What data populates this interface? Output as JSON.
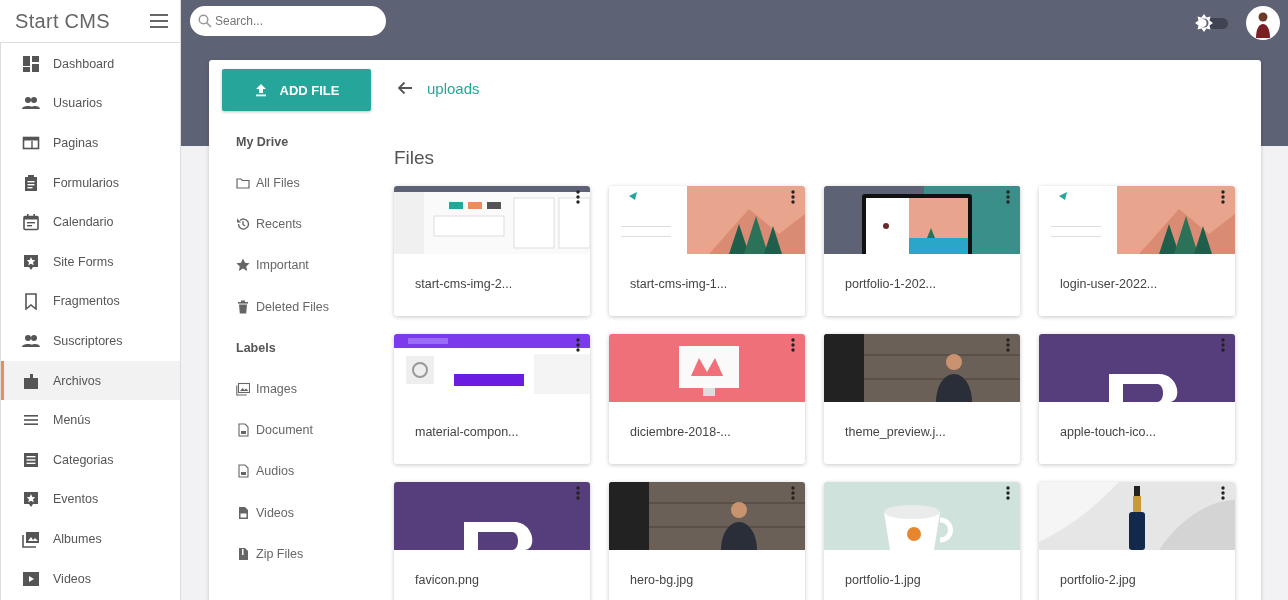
{
  "app": {
    "title": "Start CMS"
  },
  "search": {
    "placeholder": "Search..."
  },
  "theme_toggle": {
    "on": false
  },
  "sidebar": {
    "items": [
      {
        "label": "Dashboard",
        "selected": false
      },
      {
        "label": "Usuarios",
        "selected": false
      },
      {
        "label": "Paginas",
        "selected": false
      },
      {
        "label": "Formularios",
        "selected": false
      },
      {
        "label": "Calendario",
        "selected": false
      },
      {
        "label": "Site Forms",
        "selected": false
      },
      {
        "label": "Fragmentos",
        "selected": false
      },
      {
        "label": "Suscriptores",
        "selected": false
      },
      {
        "label": "Archivos",
        "selected": true
      },
      {
        "label": "Menús",
        "selected": false
      },
      {
        "label": "Categorias",
        "selected": false
      },
      {
        "label": "Eventos",
        "selected": false
      },
      {
        "label": "Albumes",
        "selected": false
      },
      {
        "label": "Videos",
        "selected": false
      }
    ]
  },
  "drive": {
    "add_button": "ADD FILE",
    "sections": [
      {
        "heading": "My Drive",
        "items": [
          "All Files",
          "Recents",
          "Important",
          "Deleted Files"
        ]
      },
      {
        "heading": "Labels",
        "items": [
          "Images",
          "Document",
          "Audios",
          "Videos",
          "Zip Files"
        ]
      }
    ]
  },
  "breadcrumb": {
    "folder": "uploads"
  },
  "files": {
    "heading": "Files",
    "items": [
      {
        "name": "start-cms-img-2..."
      },
      {
        "name": "start-cms-img-1..."
      },
      {
        "name": "portfolio-1-202..."
      },
      {
        "name": "login-user-2022..."
      },
      {
        "name": "material-compon..."
      },
      {
        "name": "diciembre-2018-..."
      },
      {
        "name": "theme_preview.j..."
      },
      {
        "name": "apple-touch-ico..."
      },
      {
        "name": "favicon.png"
      },
      {
        "name": "hero-bg.jpg"
      },
      {
        "name": "portfolio-1.jpg"
      },
      {
        "name": "portfolio-2.jpg"
      }
    ]
  }
}
